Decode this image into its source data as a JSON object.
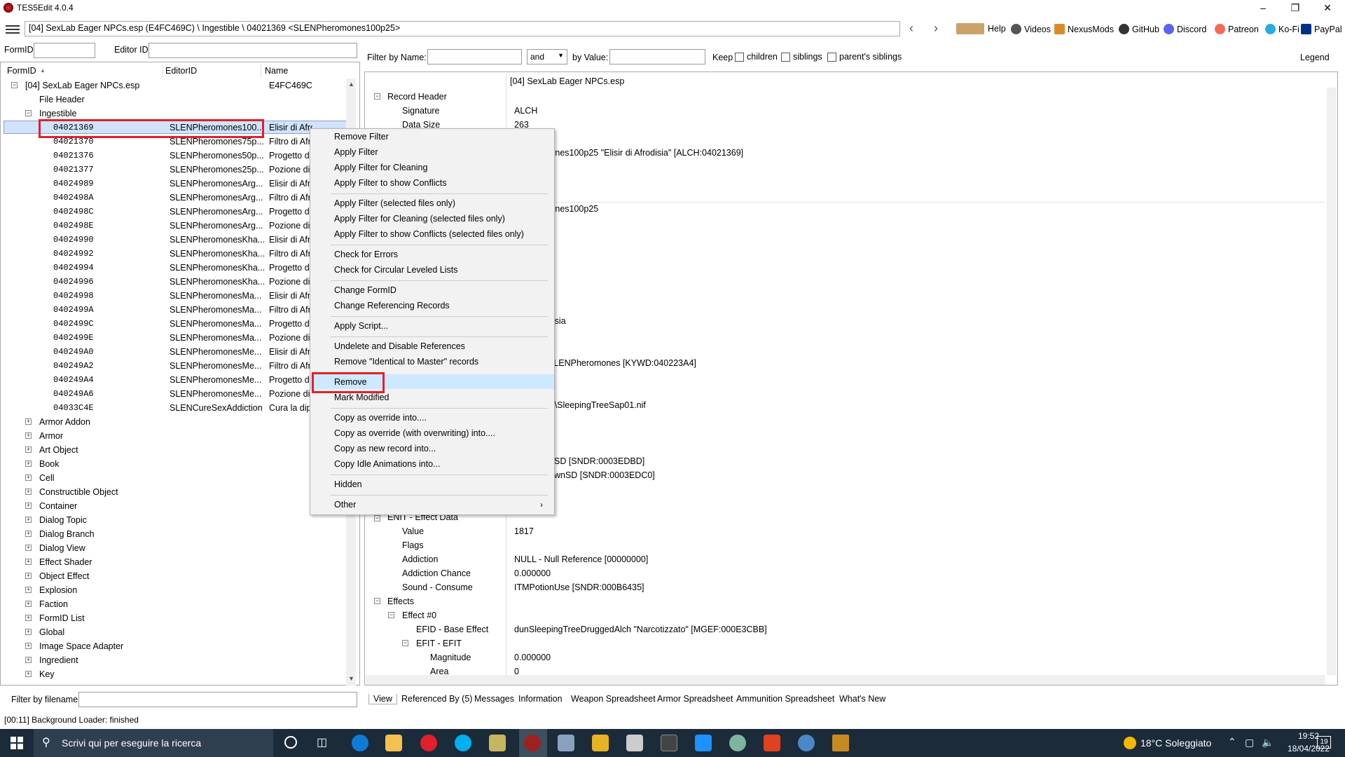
{
  "window": {
    "title": "TES5Edit 4.0.4"
  },
  "toolbar": {
    "path": "[04] SexLab Eager NPCs.esp (E4FC469C) \\ Ingestible \\ 04021369 <SLENPheromones100p25>",
    "links": [
      "Help",
      "Videos",
      "NexusMods",
      "GitHub",
      "Discord",
      "Patreon",
      "Ko-Fi",
      "PayPal"
    ]
  },
  "left": {
    "formid_label": "FormID",
    "editorid_label": "Editor ID",
    "columns": {
      "formid": "FormID",
      "editorid": "EditorID",
      "name": "Name"
    },
    "root": {
      "label": "[04] SexLab Eager NPCs.esp",
      "value": "E4FC469C"
    },
    "file_header": "File Header",
    "ingestible": "Ingestible",
    "records": [
      {
        "formid": "04021369",
        "editorid": "SLENPheromones100...",
        "name": "Elisir di Afrodisia"
      },
      {
        "formid": "04021370",
        "editorid": "SLENPheromones75p...",
        "name": "Filtro di Afr"
      },
      {
        "formid": "04021376",
        "editorid": "SLENPheromones50p...",
        "name": "Progetto di"
      },
      {
        "formid": "04021377",
        "editorid": "SLENPheromones25p...",
        "name": "Pozione di"
      },
      {
        "formid": "04024989",
        "editorid": "SLENPheromonesArg...",
        "name": "Elisir di Afr"
      },
      {
        "formid": "0402498A",
        "editorid": "SLENPheromonesArg...",
        "name": "Filtro di Afr"
      },
      {
        "formid": "0402498C",
        "editorid": "SLENPheromonesArg...",
        "name": "Progetto di"
      },
      {
        "formid": "0402498E",
        "editorid": "SLENPheromonesArg...",
        "name": "Pozione di"
      },
      {
        "formid": "04024990",
        "editorid": "SLENPheromonesKha...",
        "name": "Elisir di Afr"
      },
      {
        "formid": "04024992",
        "editorid": "SLENPheromonesKha...",
        "name": "Filtro di Afr"
      },
      {
        "formid": "04024994",
        "editorid": "SLENPheromonesKha...",
        "name": "Progetto di"
      },
      {
        "formid": "04024996",
        "editorid": "SLENPheromonesKha...",
        "name": "Pozione di"
      },
      {
        "formid": "04024998",
        "editorid": "SLENPheromonesMa...",
        "name": "Elisir di Afr"
      },
      {
        "formid": "0402499A",
        "editorid": "SLENPheromonesMa...",
        "name": "Filtro di Afr"
      },
      {
        "formid": "0402499C",
        "editorid": "SLENPheromonesMa...",
        "name": "Progetto di"
      },
      {
        "formid": "0402499E",
        "editorid": "SLENPheromonesMa...",
        "name": "Pozione di"
      },
      {
        "formid": "040249A0",
        "editorid": "SLENPheromonesMe...",
        "name": "Elisir di Afr"
      },
      {
        "formid": "040249A2",
        "editorid": "SLENPheromonesMe...",
        "name": "Filtro di Afr"
      },
      {
        "formid": "040249A4",
        "editorid": "SLENPheromonesMe...",
        "name": "Progetto di"
      },
      {
        "formid": "040249A6",
        "editorid": "SLENPheromonesMe...",
        "name": "Pozione di"
      },
      {
        "formid": "04033C4E",
        "editorid": "SLENCureSexAddiction",
        "name": "Cura la dip"
      }
    ],
    "groups": [
      "Armor Addon",
      "Armor",
      "Art Object",
      "Book",
      "Cell",
      "Constructible Object",
      "Container",
      "Dialog Topic",
      "Dialog Branch",
      "Dialog View",
      "Effect Shader",
      "Object Effect",
      "Explosion",
      "Faction",
      "FormID List",
      "Global",
      "Image Space Adapter",
      "Ingredient",
      "Key"
    ],
    "filter_label": "Filter by filename:"
  },
  "right": {
    "filter_name_label": "Filter by Name:",
    "and_label": "and",
    "by_value_label": "by Value:",
    "keep_label": "Keep",
    "children_label": "children",
    "siblings_label": "siblings",
    "parents_siblings_label": "parent's siblings",
    "legend_label": "Legend",
    "file_column": "[04] SexLab Eager NPCs.esp",
    "record_header": "Record Header",
    "signature_label": "Signature",
    "signature_value": "ALCH",
    "datasize_label": "Data Size",
    "datasize_value": "263",
    "v_name": "mones100p25 \"Elisir di Afrodisia\" [ALCH:04021369]",
    "v_edid": "mones100p25",
    "v_full": "odisia",
    "v_kywd": "nSLENPheromones [KYWD:040223A4]",
    "v_model": "est\\SleepingTreeSap01.nif",
    "v_ysnd": "UpSD [SNDR:0003EDBD]",
    "v_zsnd": "DownSD [SNDR:0003EDC0]",
    "enit_label": "ENIT - Effect Data",
    "value_label": "Value",
    "value_value": "1817",
    "flags_label": "Flags",
    "addiction_label": "Addiction",
    "addiction_value": "NULL - Null Reference [00000000]",
    "addiction_chance_label": "Addiction Chance",
    "addiction_chance_value": "0.000000",
    "sound_label": "Sound - Consume",
    "sound_value": "ITMPotionUse [SNDR:000B6435]",
    "effects_label": "Effects",
    "effect0_label": "Effect #0",
    "efid_label": "EFID - Base Effect",
    "efid_value": "dunSleepingTreeDruggedAlch \"Narcotizzato\" [MGEF:000E3CBB]",
    "efit_label": "EFIT - EFIT",
    "magnitude_label": "Magnitude",
    "magnitude_value": "0.000000",
    "area_label": "Area",
    "area_value": "0"
  },
  "context_menu": {
    "items": [
      "Remove Filter",
      "Apply Filter",
      "Apply Filter for Cleaning",
      "Apply Filter to show Conflicts",
      "Apply Filter (selected files only)",
      "Apply Filter for Cleaning (selected files only)",
      "Apply Filter to show Conflicts (selected files only)",
      "Check for Errors",
      "Check for Circular Leveled Lists",
      "Change FormID",
      "Change Referencing Records",
      "Apply Script...",
      "Undelete and Disable References",
      "Remove \"Identical to Master\" records",
      "Remove",
      "Mark Modified",
      "Copy as override into....",
      "Copy as override (with overwriting) into....",
      "Copy as new record into...",
      "Copy Idle Animations into...",
      "Hidden",
      "Other"
    ]
  },
  "tabs": [
    "View",
    "Referenced By (5)",
    "Messages",
    "Information",
    "Weapon Spreadsheet",
    "Armor Spreadsheet",
    "Ammunition Spreadsheet",
    "What's New"
  ],
  "status": "[00:11] Background Loader: finished",
  "taskbar": {
    "search_placeholder": "Scrivi qui per eseguire la ricerca",
    "weather": "18°C  Soleggiato",
    "time": "19:52",
    "date": "18/04/2022",
    "notif_count": "19"
  },
  "colors": {
    "selection": "#cfe4fb",
    "highlight": "#cde8ff",
    "red_box": "#e3202a",
    "taskbar": "#1b2b3a"
  }
}
